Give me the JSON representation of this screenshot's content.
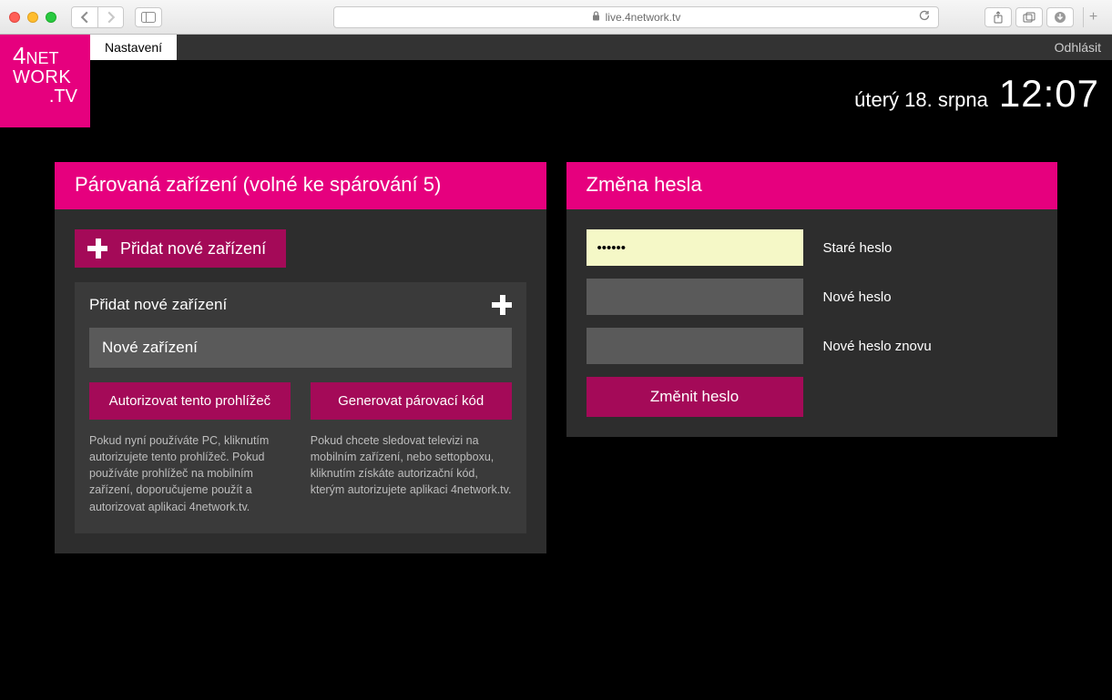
{
  "browser": {
    "url": "live.4network.tv"
  },
  "app": {
    "logo": {
      "line1a": "4",
      "line1b": "NET",
      "line2": "WORK",
      "line3": ".TV"
    },
    "tabs": {
      "settings": "Nastavení"
    },
    "logout": "Odhlásit",
    "dateString": "úterý 18. srpna",
    "clock": "12:07"
  },
  "panels": {
    "devices": {
      "title": "Párovaná zařízení (volné ke spárování 5)",
      "addButton": "Přidat nové zařízení",
      "innerHeader": "Přidat nové zařízení",
      "deviceNameValue": "Nové zařízení",
      "authorizeBrowser": "Autorizovat tento prohlížeč",
      "generateCode": "Generovat párovací kód",
      "helpLeft": "Pokud nyní používáte PC, kliknutím autorizujete tento prohlížeč. Pokud používáte prohlížeč na mobilním zařízení, doporučujeme použít a autorizovat aplikaci 4network.tv.",
      "helpRight": "Pokud chcete sledovat televizi na mobilním zařízení, nebo settopboxu, kliknutím získáte autorizační kód, kterým autorizujete aplikaci 4network.tv."
    },
    "password": {
      "title": "Změna hesla",
      "oldPasswordLabel": "Staré heslo",
      "oldPasswordValue": "••••••",
      "newPasswordLabel": "Nové heslo",
      "newPasswordAgainLabel": "Nové heslo znovu",
      "submit": "Změnit heslo"
    }
  }
}
